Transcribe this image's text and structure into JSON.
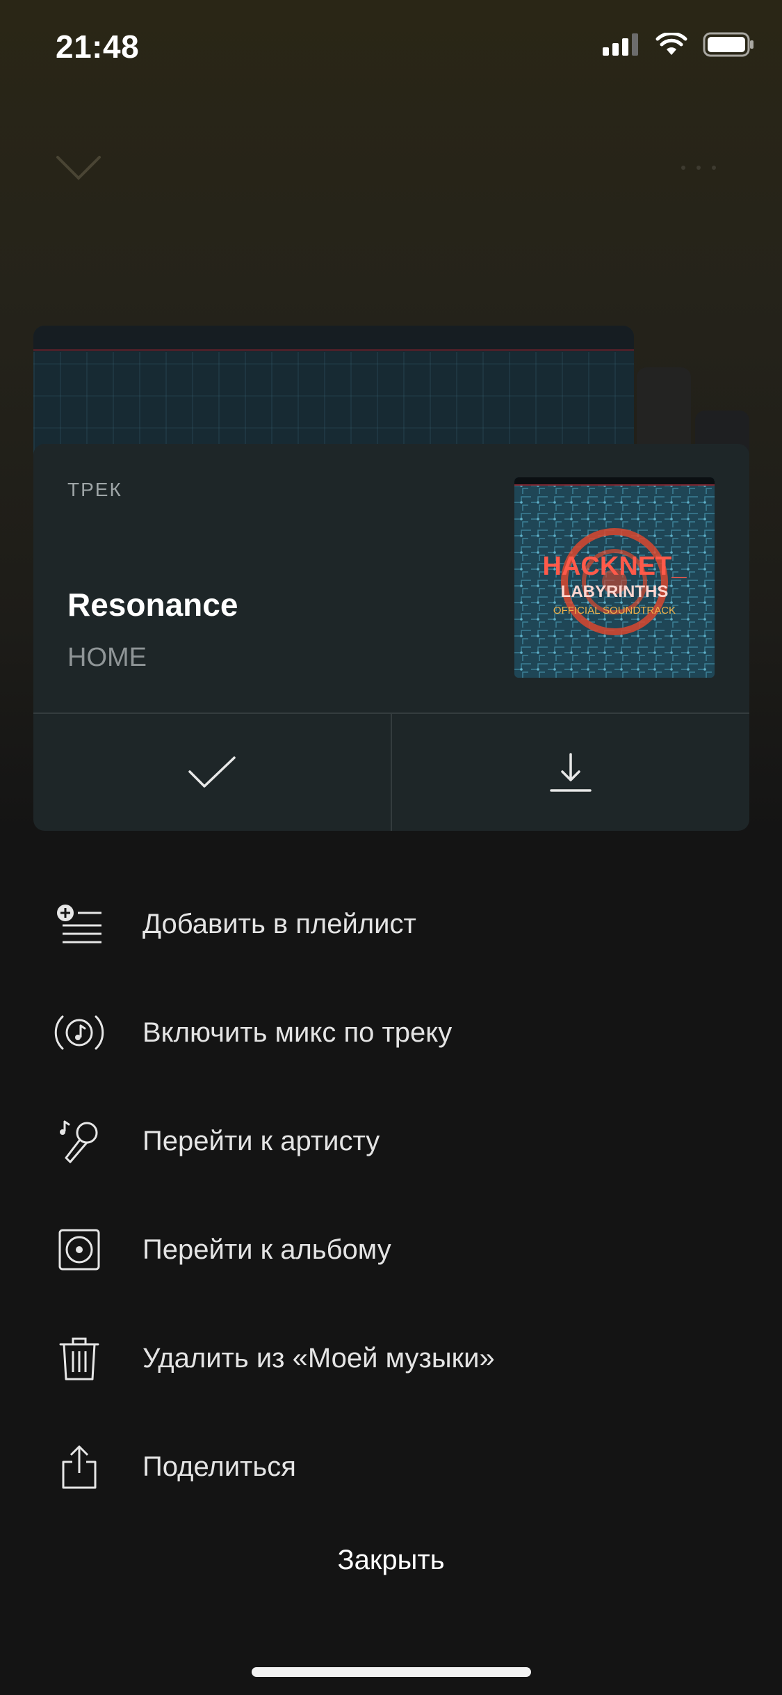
{
  "status_bar": {
    "time": "21:48",
    "icons": [
      "cellular-signal-icon",
      "wifi-icon",
      "battery-icon"
    ]
  },
  "player_background": {
    "icons": [
      "chevron-down-icon",
      "more-icon"
    ]
  },
  "track_card": {
    "type_label": "ТРЕК",
    "title": "Resonance",
    "artist": "HOME",
    "cover": {
      "title_line1": "HACKNET_",
      "title_line2": "LABYRINTHS",
      "title_line3": "OFFICIAL SOUNDTRACK"
    },
    "actions": [
      {
        "name": "like",
        "icon": "checkmark-icon"
      },
      {
        "name": "download",
        "icon": "download-icon"
      }
    ]
  },
  "menu": {
    "items": [
      {
        "label": "Добавить в плейлист",
        "icon": "add-to-playlist-icon"
      },
      {
        "label": "Включить микс по треку",
        "icon": "track-mix-icon"
      },
      {
        "label": "Перейти к артисту",
        "icon": "microphone-icon"
      },
      {
        "label": "Перейти к альбому",
        "icon": "album-icon"
      },
      {
        "label": "Удалить из «Моей музыки»",
        "icon": "trash-icon"
      },
      {
        "label": "Поделиться",
        "icon": "share-icon"
      }
    ],
    "close_label": "Закрыть"
  },
  "colors": {
    "sheet_background": "#141414",
    "card_background": "#1e2628",
    "primary_text": "#ffffff",
    "secondary_text": "#8f9597",
    "cover_accent": "#e0533b"
  }
}
